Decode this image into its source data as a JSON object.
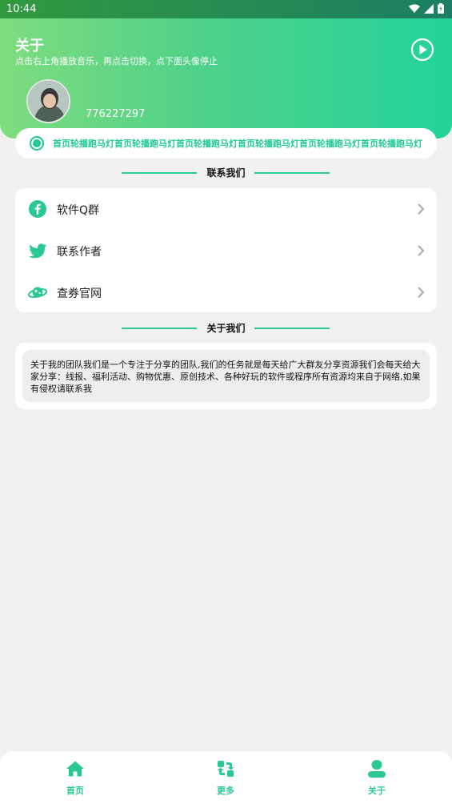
{
  "status_bar": {
    "time": "10:44",
    "wifi_icon": "wifi-icon",
    "signal_icon": "signal-icon",
    "battery_icon": "battery-icon"
  },
  "header": {
    "title": "关于",
    "subtitle": "点击右上角播放音乐，再点击切换，点下面头像停止",
    "play_icon": "play-circle-icon",
    "user_id": "776227297"
  },
  "marquee": {
    "text": "首页轮播跑马灯首页轮播跑马灯首页轮播跑马灯首页轮播跑马灯首页轮播跑马灯首页轮播跑马灯"
  },
  "contact_section": {
    "title": "联系我们",
    "items": [
      {
        "label": "软件Q群",
        "icon": "facebook-icon"
      },
      {
        "label": "联系作者",
        "icon": "twitter-icon"
      },
      {
        "label": "查券官网",
        "icon": "planet-icon"
      }
    ]
  },
  "about_section": {
    "title": "关于我们",
    "body": "关于我的团队我们是一个专注于分享的团队,我们的任务就是每天给广大群友分享资源我们会每天给大家分享：线报、福利活动、购物优惠、原创技术、各种好玩的软件或程序所有资源均来自于网络,如果有侵权请联系我"
  },
  "bottom_nav": {
    "items": [
      {
        "label": "首页",
        "icon": "home-icon"
      },
      {
        "label": "更多",
        "icon": "switch-icon"
      },
      {
        "label": "关于",
        "icon": "user-icon"
      }
    ]
  },
  "colors": {
    "accent": "#2bc992",
    "header_start": "#7edc7e",
    "header_end": "#22d39a",
    "background": "#f1f2ef"
  }
}
